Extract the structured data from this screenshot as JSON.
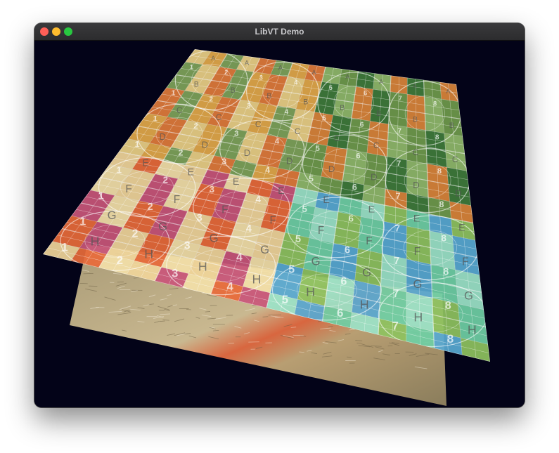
{
  "window": {
    "title": "LibVT Demo",
    "controls": [
      "close",
      "minimize",
      "zoom"
    ]
  },
  "viewport": {
    "background": "#030318",
    "front_plane": {
      "row_labels": [
        "A",
        "B",
        "C",
        "D",
        "E",
        "F",
        "G",
        "H"
      ],
      "column_numbers": [
        "1",
        "2",
        "3",
        "4",
        "5",
        "6",
        "7",
        "8"
      ],
      "quadrant_colors": {
        "top_left": [
          "#e9cf86",
          "#e2a84a",
          "#e07b3b",
          "#7ea35a"
        ],
        "top_right": [
          "#8fb96a",
          "#6f9a4c",
          "#d9843a",
          "#3f7b3b"
        ],
        "bottom_left": [
          "#f0d59a",
          "#e86a3a",
          "#c9567a",
          "#f3e0a8"
        ],
        "bottom_right": [
          "#9be3c8",
          "#58a9d3",
          "#8ec25f",
          "#6fcfa5"
        ]
      }
    },
    "back_plane": {
      "texture": "fur-photo",
      "colors": [
        "#c9b48a",
        "#e05a3a",
        "#8a7a5a"
      ]
    }
  }
}
